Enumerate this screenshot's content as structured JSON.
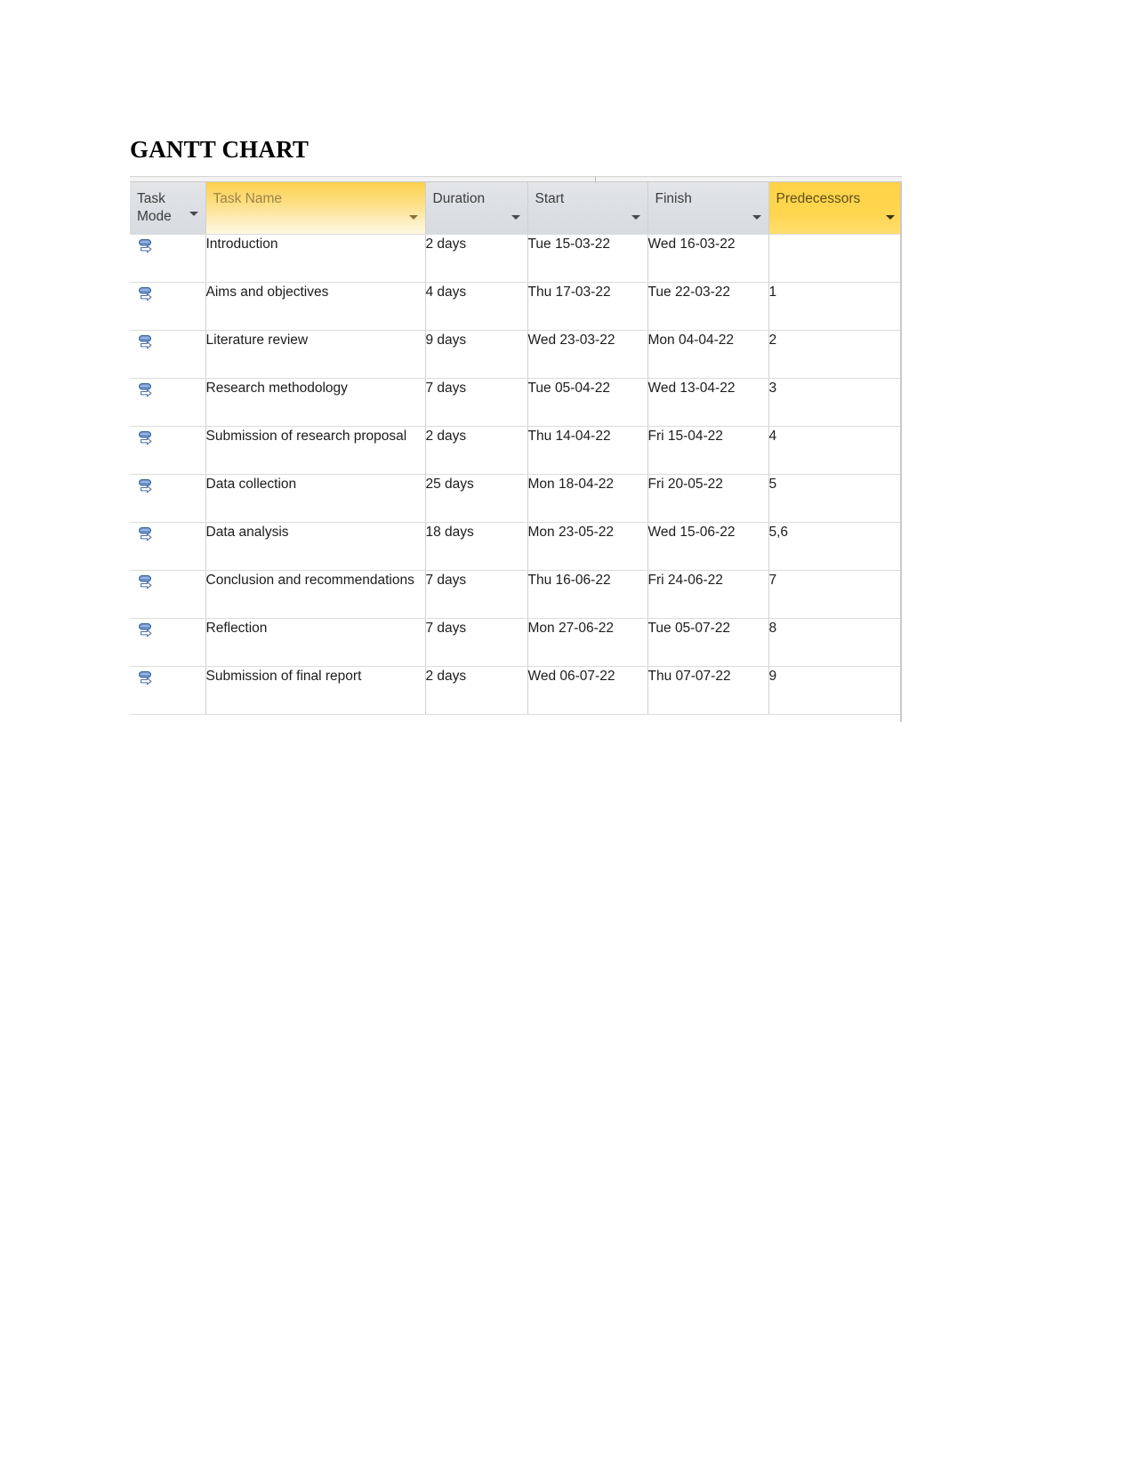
{
  "document": {
    "title": "GANTT CHART"
  },
  "table": {
    "name": "gantt-task-table",
    "columns": [
      {
        "key": "task_mode",
        "label": "Task\nMode",
        "style": "grey",
        "icon": "chevron-down-icon"
      },
      {
        "key": "task_name",
        "label": "Task Name",
        "style": "gold-grad",
        "icon": "chevron-down-icon"
      },
      {
        "key": "duration",
        "label": "Duration",
        "style": "grey",
        "icon": "chevron-down-icon"
      },
      {
        "key": "start",
        "label": "Start",
        "style": "grey",
        "icon": "chevron-down-icon"
      },
      {
        "key": "finish",
        "label": "Finish",
        "style": "grey",
        "icon": "chevron-down-icon"
      },
      {
        "key": "predecessors",
        "label": "Predecessors",
        "style": "gold-solid",
        "icon": "chevron-down-icon"
      }
    ],
    "rows": [
      {
        "task_mode_icon": "auto-scheduled-icon",
        "task_name": "Introduction",
        "duration": "2 days",
        "start": "Tue 15-03-22",
        "finish": "Wed 16-03-22",
        "predecessors": ""
      },
      {
        "task_mode_icon": "auto-scheduled-icon",
        "task_name": "Aims and objectives",
        "duration": "4 days",
        "start": "Thu 17-03-22",
        "finish": "Tue 22-03-22",
        "predecessors": "1"
      },
      {
        "task_mode_icon": "auto-scheduled-icon",
        "task_name": "Literature review",
        "duration": "9 days",
        "start": "Wed 23-03-22",
        "finish": "Mon 04-04-22",
        "predecessors": "2"
      },
      {
        "task_mode_icon": "auto-scheduled-icon",
        "task_name": "Research methodology",
        "duration": "7 days",
        "start": "Tue 05-04-22",
        "finish": "Wed 13-04-22",
        "predecessors": "3"
      },
      {
        "task_mode_icon": "auto-scheduled-icon",
        "task_name": "Submission of research proposal",
        "duration": "2 days",
        "start": "Thu 14-04-22",
        "finish": "Fri 15-04-22",
        "predecessors": "4"
      },
      {
        "task_mode_icon": "auto-scheduled-icon",
        "task_name": "Data collection",
        "duration": "25 days",
        "start": "Mon 18-04-22",
        "finish": "Fri 20-05-22",
        "predecessors": "5"
      },
      {
        "task_mode_icon": "auto-scheduled-icon",
        "task_name": "Data analysis",
        "duration": "18 days",
        "start": "Mon 23-05-22",
        "finish": "Wed 15-06-22",
        "predecessors": "5,6"
      },
      {
        "task_mode_icon": "auto-scheduled-icon",
        "task_name": "Conclusion and recommendations",
        "duration": "7 days",
        "start": "Thu 16-06-22",
        "finish": "Fri 24-06-22",
        "predecessors": "7"
      },
      {
        "task_mode_icon": "auto-scheduled-icon",
        "task_name": "Reflection",
        "duration": "7 days",
        "start": "Mon 27-06-22",
        "finish": "Tue 05-07-22",
        "predecessors": "8"
      },
      {
        "task_mode_icon": "auto-scheduled-icon",
        "task_name": "Submission of final report",
        "duration": "2 days",
        "start": "Wed 06-07-22",
        "finish": "Thu 07-07-22",
        "predecessors": "9"
      }
    ]
  },
  "colors": {
    "header_grey": "#dcdfe3",
    "header_gold_top": "#fcd14e",
    "header_gold_bottom": "#fef8e3",
    "predecessors_gold": "#ffd348",
    "grid_line": "#dcdcdc",
    "text": "#1c1c1c",
    "icon_blue": "#5b80b9"
  }
}
